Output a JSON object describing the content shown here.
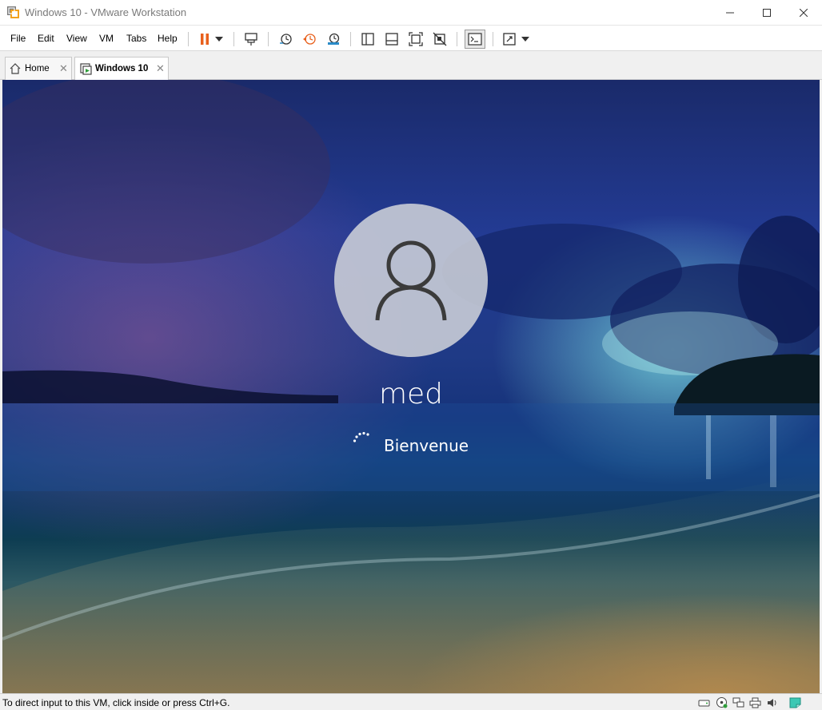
{
  "window": {
    "title": "Windows 10 - VMware Workstation",
    "controls": {
      "minimize_icon": "minimize-icon",
      "maximize_icon": "maximize-icon",
      "close_icon": "close-icon"
    }
  },
  "menu": {
    "items": [
      "File",
      "Edit",
      "View",
      "VM",
      "Tabs",
      "Help"
    ]
  },
  "toolbar": {
    "icons": [
      "pause-icon",
      "dropdown-icon",
      "send-ctrl-alt-del-icon",
      "snapshot-icon",
      "revert-snapshot-icon",
      "snapshot-manager-icon",
      "show-library-icon",
      "thumbnail-bar-icon",
      "full-screen-icon",
      "unity-icon",
      "console-view-icon",
      "stretch-guest-icon",
      "dropdown-icon"
    ],
    "accent_color": "#e8601c"
  },
  "tabs": [
    {
      "label": "Home",
      "icon": "home-icon",
      "active": false
    },
    {
      "label": "Windows 10",
      "icon": "vm-icon",
      "active": true
    }
  ],
  "vm": {
    "username": "med",
    "welcome_text": "Bienvenue",
    "avatar_icon": "user-avatar-icon",
    "spinner_icon": "loading-spinner-icon"
  },
  "statusbar": {
    "message": "To direct input to this VM, click inside or press Ctrl+G.",
    "device_icons": [
      "hard-disk-icon",
      "cd-dvd-icon",
      "network-adapter-icon",
      "printer-icon",
      "sound-card-icon",
      "message-log-icon"
    ]
  }
}
